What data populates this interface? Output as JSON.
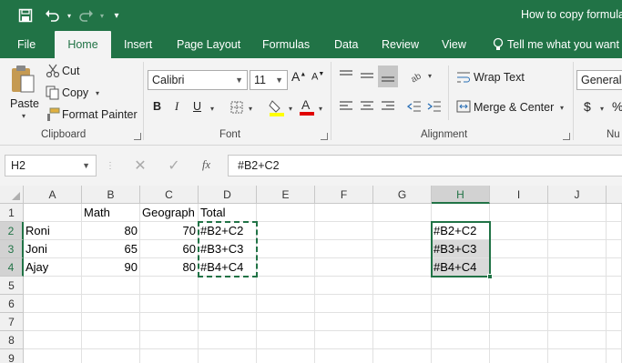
{
  "titlebar": {
    "title": "How to copy formula",
    "icons": [
      "save-icon",
      "undo-icon",
      "redo-icon",
      "customize-qat-icon"
    ]
  },
  "tabs": [
    {
      "label": "File"
    },
    {
      "label": "Home",
      "active": true
    },
    {
      "label": "Insert"
    },
    {
      "label": "Page Layout"
    },
    {
      "label": "Formulas"
    },
    {
      "label": "Data"
    },
    {
      "label": "Review"
    },
    {
      "label": "View"
    },
    {
      "label": "Tell me what you want t"
    }
  ],
  "ribbon": {
    "clipboard": {
      "paste": "Paste",
      "cut": "Cut",
      "copy": "Copy",
      "format_painter": "Format Painter",
      "group_label": "Clipboard"
    },
    "font": {
      "font_name": "Calibri",
      "font_size": "11",
      "bold": "B",
      "italic": "I",
      "underline": "U",
      "group_label": "Font",
      "highlight_color": "#ffff00",
      "font_color": "#e00000"
    },
    "alignment": {
      "wrap_text": "Wrap Text",
      "merge_center": "Merge & Center",
      "group_label": "Alignment"
    },
    "number": {
      "format": "General",
      "currency": "$",
      "percent": "%",
      "group_label": "Nu"
    }
  },
  "formula_bar": {
    "name_box": "H2",
    "fx": "fx",
    "formula": "#B2+C2"
  },
  "sheet": {
    "columns": [
      "A",
      "B",
      "C",
      "D",
      "E",
      "F",
      "G",
      "H",
      "I",
      "J"
    ],
    "selected_column": "H",
    "rows": [
      "1",
      "2",
      "3",
      "4",
      "5",
      "6",
      "7",
      "8",
      "9"
    ],
    "selected_rows": [
      "2",
      "3",
      "4"
    ],
    "cells": {
      "B1": "Math",
      "C1": "Geograph",
      "D1": "Total",
      "A2": "Roni",
      "B2": "80",
      "C2": "70",
      "D2": "#B2+C2",
      "A3": "Joni",
      "B3": "65",
      "C3": "60",
      "D3": "#B3+C3",
      "A4": "Ajay",
      "B4": "90",
      "C4": "80",
      "D4": "#B4+C4",
      "H2": "#B2+C2",
      "H3": "#B3+C3",
      "H4": "#B4+C4"
    },
    "accent_color": "#217346"
  }
}
